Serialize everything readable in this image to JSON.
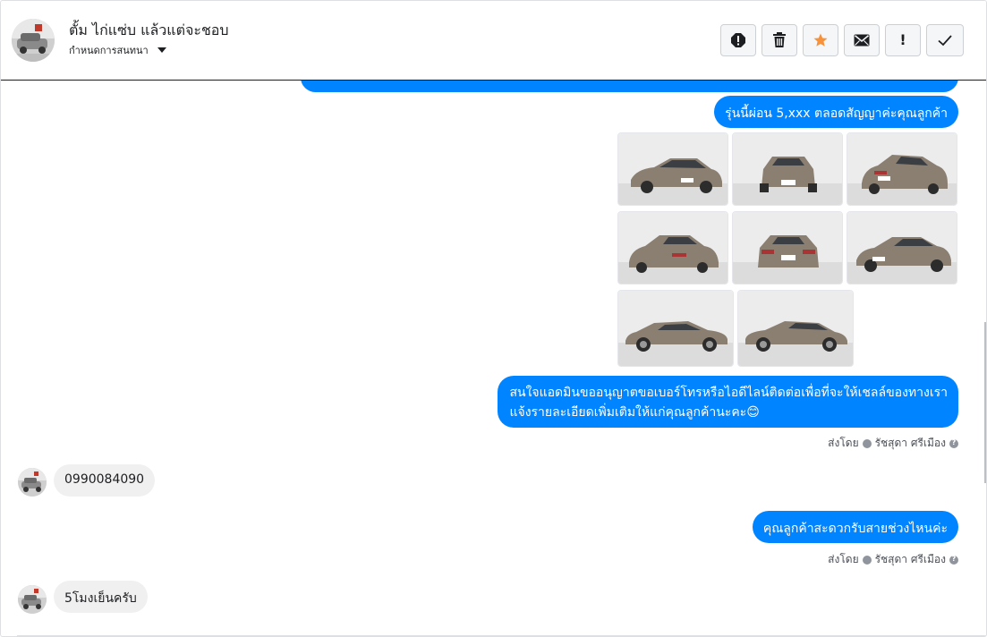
{
  "header": {
    "contact_name": "ตั้ม ไก่แซ่บ แล้วแต่จะชอบ",
    "conversation_setting": "กำหนดการสนทนา",
    "actions": [
      {
        "name": "spam-button",
        "icon": "alert-circle-icon"
      },
      {
        "name": "delete-button",
        "icon": "trash-icon"
      },
      {
        "name": "star-button",
        "icon": "star-icon",
        "color": "#f7923b"
      },
      {
        "name": "mark-unread-button",
        "icon": "envelope-icon"
      },
      {
        "name": "important-button",
        "icon": "exclamation-icon",
        "label": "!"
      },
      {
        "name": "done-button",
        "icon": "check-icon"
      }
    ]
  },
  "messages": {
    "m1": "รุ่นนี้ผ่อน 5,xxx ตลอดสัญญาค่ะคุณลูกค้า",
    "m2_line1": "สนใจแอดมินขออนุญาตขอเบอร์โทรหรือไอดีไลน์ติดต่อเพื่อที่จะให้เชลล์ของทางเรา",
    "m2_line2": "แจ้งรายละเอียดเพิ่มเติมให้แก่คุณลูกค้านะคะ😊",
    "m3": "0990084090",
    "m4": "คุณลูกค้าสะดวกรับสายช่วงไหนค่ะ",
    "m5": "5โมงเย็นครับ"
  },
  "sent_by": {
    "prefix": "ส่งโดย",
    "name": "รัชสุดา ศรีเมือง"
  },
  "photos_alt": "car-photo",
  "colors": {
    "outgoing_bubble": "#0084ff",
    "incoming_bubble": "#f1f0f0",
    "star": "#f7923b"
  }
}
